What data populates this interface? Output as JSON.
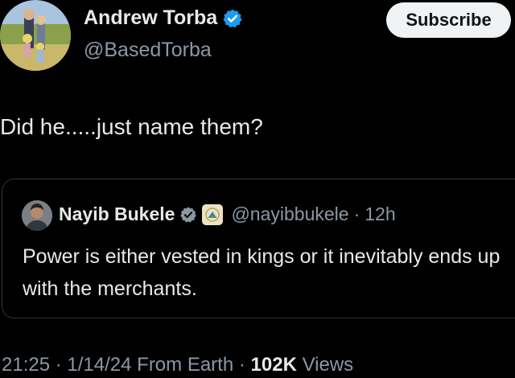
{
  "author": {
    "name": "Andrew Torba",
    "handle": "@BasedTorba",
    "verified_color": "#1d9bf0"
  },
  "subscribe_label": "Subscribe",
  "tweet": {
    "text": "Did he.....just name them?"
  },
  "quote": {
    "name": "Nayib Bukele",
    "handle": "@nayibbukele",
    "separator": "·",
    "time": "12h",
    "text": "Power is either vested in kings or it inevitably ends up with the merchants."
  },
  "meta": {
    "time": "21:25",
    "sep1": "·",
    "date": "1/14/24",
    "source": "From Earth",
    "sep2": "·",
    "views_count": "102K",
    "views_label": "Views"
  }
}
